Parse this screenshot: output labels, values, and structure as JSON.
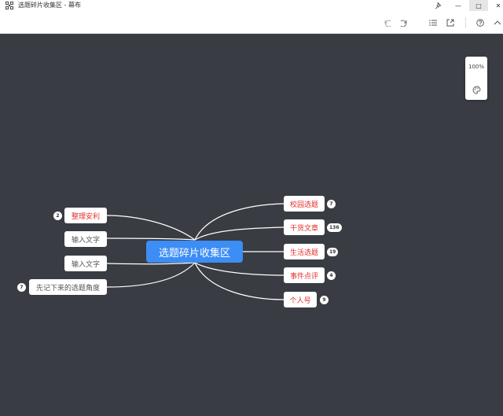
{
  "window": {
    "title": "选题碎片收集区 - 幕布",
    "controls": {
      "pin": "pin-icon",
      "minimize": "—",
      "maximize": "□",
      "close": "✕"
    }
  },
  "toolbar": {
    "icons": [
      "undo-icon",
      "redo-icon",
      "outline-view-icon",
      "export-icon",
      "help-icon",
      "collapse-icon"
    ]
  },
  "zoom": {
    "level": "100%"
  },
  "mindmap": {
    "central": "选题碎片收集区",
    "right_nodes": [
      {
        "label": "校园选题",
        "count": "7"
      },
      {
        "label": "干货文章",
        "count": "136"
      },
      {
        "label": "生活选题",
        "count": "19"
      },
      {
        "label": "事件点评",
        "count": "4"
      },
      {
        "label": "个人号",
        "count": "9"
      }
    ],
    "left_nodes": [
      {
        "label": "整理安利",
        "count": "2"
      },
      {
        "label": "输入文字"
      },
      {
        "label": "输入文字"
      },
      {
        "label": "先记下来的选题角度",
        "count": "7"
      }
    ]
  },
  "colors": {
    "canvas": "#393c43",
    "central_node": "#3c8df5",
    "node_text_red": "#e0312a",
    "node_text_gray": "#555555",
    "edge": "#ffffff"
  }
}
